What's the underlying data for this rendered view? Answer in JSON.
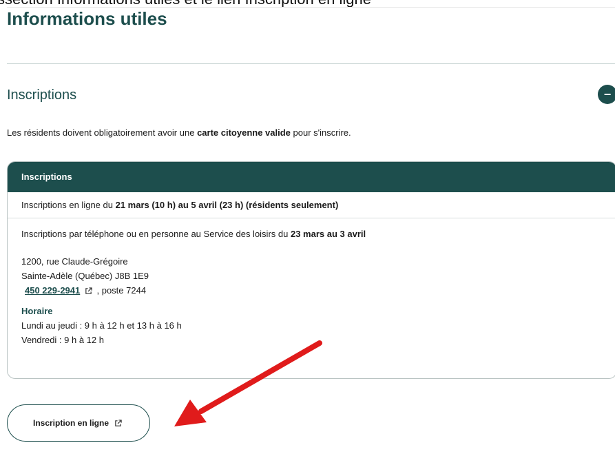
{
  "cut_caption": "ssection Informations utiles et le lien Inscription en ligne",
  "page": {
    "title": "Informations utiles"
  },
  "accordion": {
    "title": "Inscriptions",
    "toggle_symbol": "−",
    "intro": {
      "before": "Les résidents doivent obligatoirement avoir une ",
      "bold": "carte citoyenne valide",
      "after": " pour s'inscrire."
    }
  },
  "info_table": {
    "header": "Inscriptions",
    "online_row": {
      "text": "Inscriptions en ligne du ",
      "bold": "21 mars (10 h) au 5 avril (23 h)  (résidents seulement)"
    },
    "phone_row": {
      "text": "Inscriptions par téléphone ou en personne au Service des loisirs du ",
      "bold": "23 mars au 3 avril",
      "address_line1": "1200, rue Claude-Grégoire",
      "address_line2": "Sainte-Adèle (Québec) J8B 1E9",
      "phone": "450 229-2941",
      "phone_suffix": ", poste 7244",
      "hours_title": "Horaire",
      "hours_line1": "Lundi au jeudi : 9 h à 12 h et 13 h à 16 h",
      "hours_line2": "Vendredi : 9 h à 12 h"
    }
  },
  "online_button": {
    "label": "Inscription en ligne"
  },
  "icons": {
    "external_link": "external-link-icon",
    "toggle": "minus-circle-icon",
    "annotation": "red-arrow"
  },
  "colors": {
    "brand": "#1d4e4d",
    "arrow": "#e01b1b",
    "border": "#b9c3c2"
  }
}
